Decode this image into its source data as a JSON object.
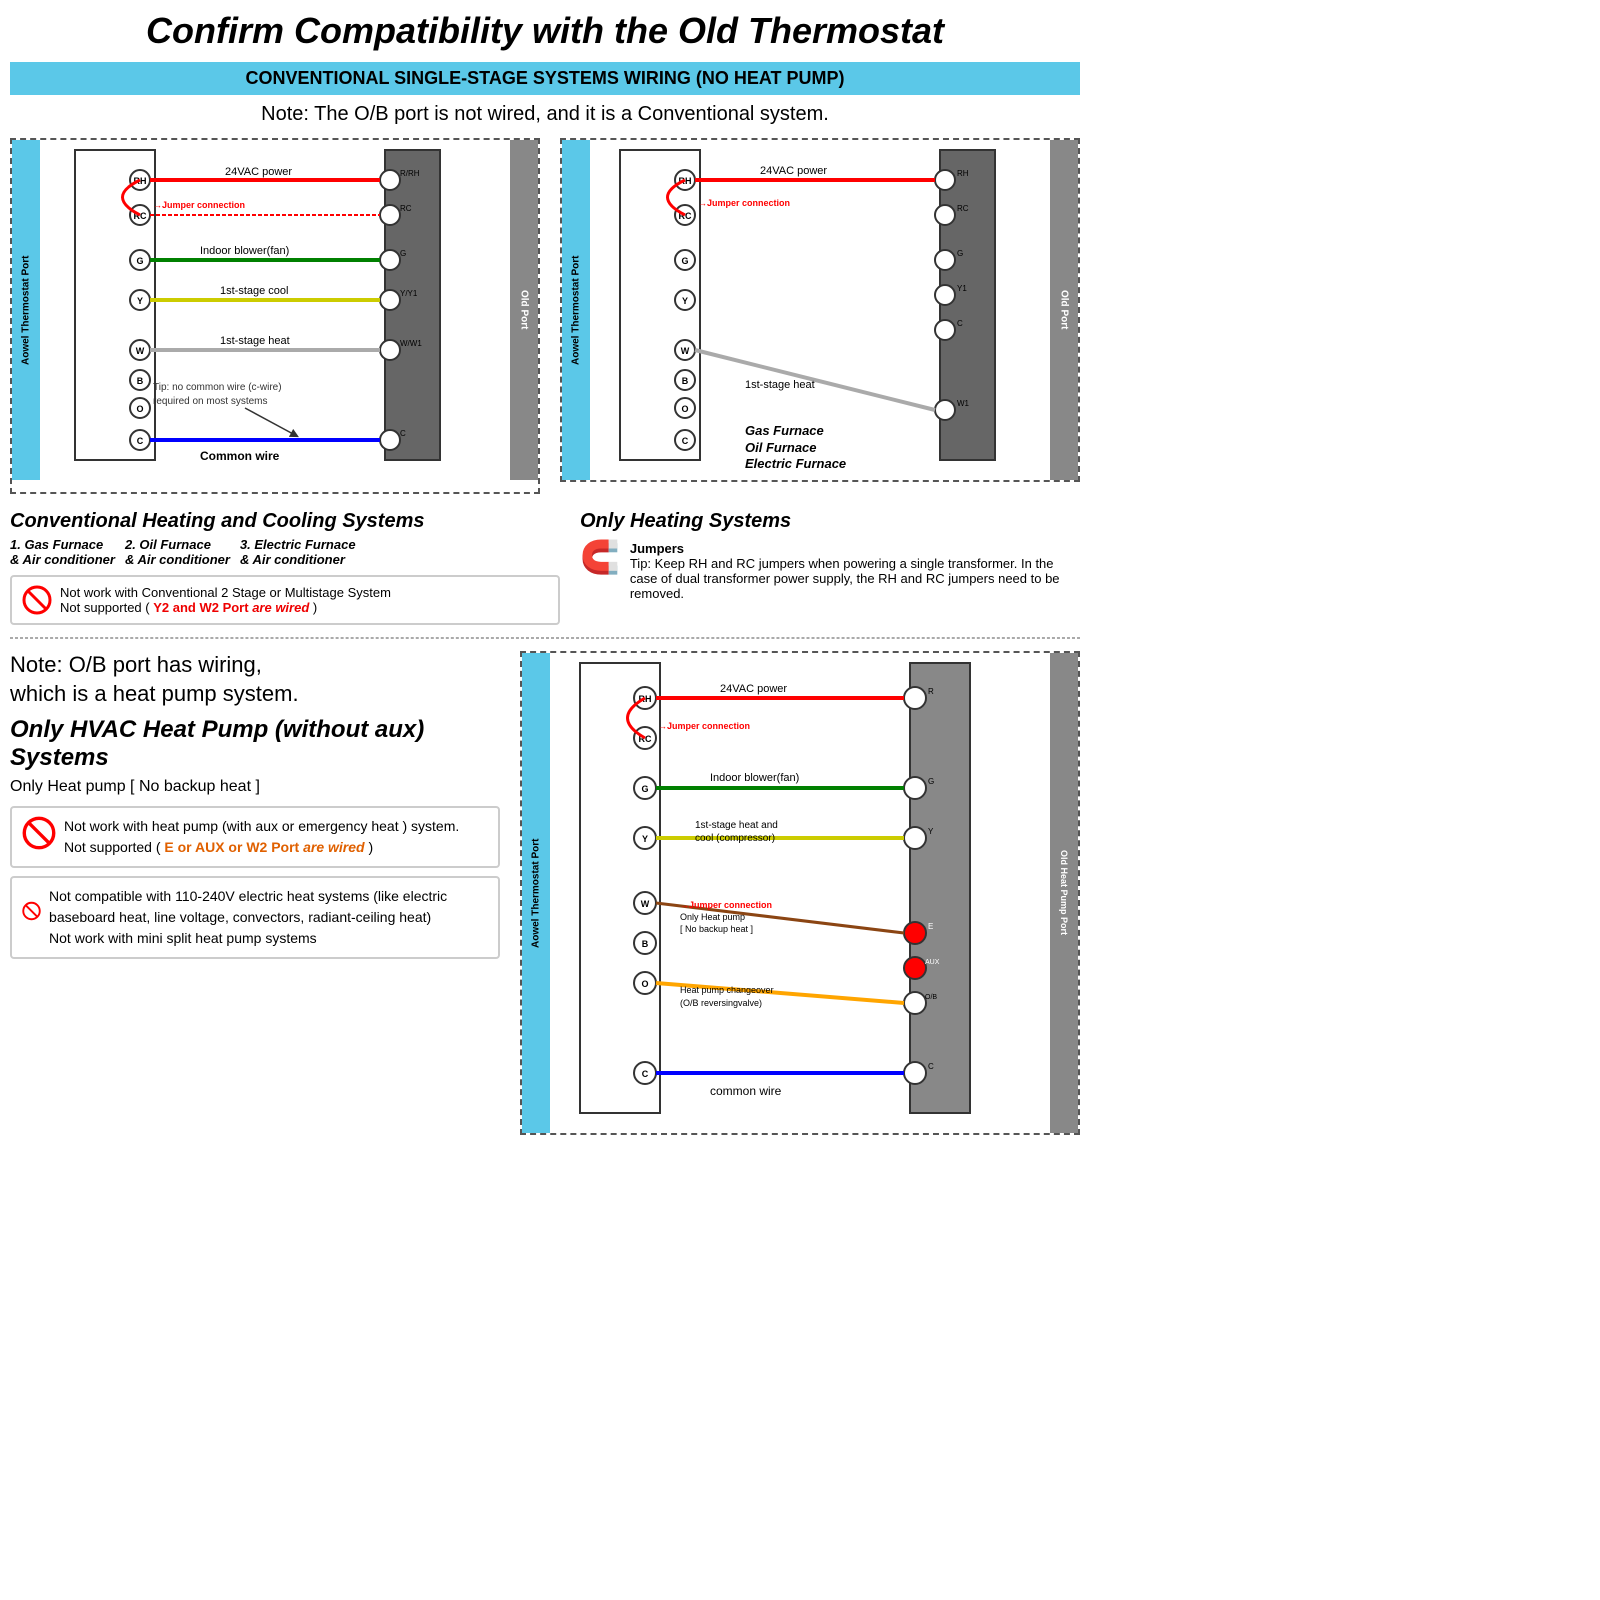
{
  "page": {
    "title": "Confirm Compatibility with the Old Thermostat",
    "top_banner": "CONVENTIONAL SINGLE-STAGE SYSTEMS WIRING (NO HEAT PUMP)",
    "top_note": "Note: The O/B port is not wired, and it is a Conventional system.",
    "bottom_heat_pump_note": "Note: O/B port has wiring,\nwhich is a heat pump system.",
    "heat_pump_title": "Only HVAC Heat Pump (without aux) Systems",
    "heat_pump_sub": "Only Heat pump [ No backup heat ]"
  },
  "left_diagram": {
    "port_label_left": "Aowel Thermostat Port",
    "port_label_right": "Old Port",
    "terminals_left": [
      "RH",
      "RC",
      "G",
      "Y",
      "",
      "W",
      "B",
      "O",
      "C"
    ],
    "wires": [
      {
        "label": "24VAC power",
        "color": "red",
        "terminal_right": "R/RH"
      },
      {
        "label": "Jumper connection",
        "color": "red",
        "terminal_right": "RC",
        "is_jumper": true
      },
      {
        "label": "Indoor blower(fan)",
        "color": "green",
        "terminal_right": "G"
      },
      {
        "label": "1st-stage cool",
        "color": "yellow",
        "terminal_right": "Y/Y1"
      },
      {
        "label": "1st-stage heat",
        "color": "white",
        "terminal_right": "W/W1"
      },
      {
        "label": "Common wire",
        "color": "blue",
        "terminal_right": "C"
      }
    ],
    "tip_text": "Tip: no common wire (c-wire)\nrequired on most systems"
  },
  "right_diagram_top": {
    "port_label_left": "Aowel Thermostat Port",
    "port_label_right": "Old Port",
    "terminals_left": [
      "RH",
      "RC",
      "G",
      "Y",
      "",
      "W",
      "B",
      "O",
      "C"
    ],
    "terminals_right": [
      "RH",
      "RC",
      "G",
      "Y1",
      "C",
      "",
      "",
      "",
      "W1"
    ],
    "wires": [
      {
        "label": "24VAC power",
        "color": "red"
      },
      {
        "label": "Jumper connection",
        "color": "red",
        "is_jumper": true
      },
      {
        "label": "1st-stage heat",
        "color": "white"
      }
    ],
    "furnace_types": "Gas Furnace\nOil Furnace\nElectric Furnace"
  },
  "conventional_section": {
    "title": "Conventional Heating and Cooling Systems",
    "items": [
      "1. Gas Furnace\n& Air conditioner",
      "2. Oil Furnace\n& Air conditioner",
      "3. Electric Furnace\n& Air conditioner"
    ],
    "warning": "Not work with Conventional 2 Stage or Multistage System\nNot supported ( Y2 and W2 Port are wired )"
  },
  "only_heating_section": {
    "title": "Only Heating Systems",
    "jumper_tip": "Tip: Keep RH and RC jumpers when powering a single transformer. In the case of dual transformer power supply, the RH and RC jumpers need to be removed.",
    "jumpers_label": "Jumpers"
  },
  "heat_pump_warnings": [
    {
      "text": "Not work with heat pump (with aux or emergency heat ) system.\nNot supported ( E or AUX or W2 Port are wired )",
      "highlight": "E or AUX or W2 Port are wired"
    },
    {
      "text": "Not compatible with 110-240V electric heat systems (like electric baseboard heat, line voltage, convectors, radiant-ceiling heat)\nNot work with mini split heat pump systems"
    }
  ],
  "heat_pump_diagram": {
    "port_label_left": "Aowel Thermostat Port",
    "port_label_right": "Old Heat Pump Port",
    "terminals_left": [
      "RH",
      "RC",
      "G",
      "Y",
      "",
      "W",
      "B",
      "O",
      "C"
    ],
    "terminals_right": [
      "R",
      "",
      "G",
      "Y",
      "",
      "E",
      "AUX",
      "O/B",
      "C"
    ],
    "wires": [
      {
        "label": "24VAC power",
        "color": "red",
        "terminal_right": "R"
      },
      {
        "label": "Jumper connection",
        "color": "red",
        "is_jumper": true
      },
      {
        "label": "Indoor blower(fan)",
        "color": "green",
        "terminal_right": "G"
      },
      {
        "label": "1st-stage heat and\ncool (compressor)",
        "color": "yellow",
        "terminal_right": "Y"
      },
      {
        "label": "Jumper connection\nOnly Heat pump\n[ No backup heat ]",
        "color": "brown",
        "is_jumper": true
      },
      {
        "label": "Heat pump changeover\n(O/B reversingvalve)",
        "color": "orange",
        "terminal_right": "O/B"
      },
      {
        "label": "common wire",
        "color": "blue",
        "terminal_right": "C"
      }
    ]
  },
  "colors": {
    "accent_blue": "#5bc8e8",
    "old_port_gray": "#888888",
    "orange_port": "#e8a020"
  }
}
